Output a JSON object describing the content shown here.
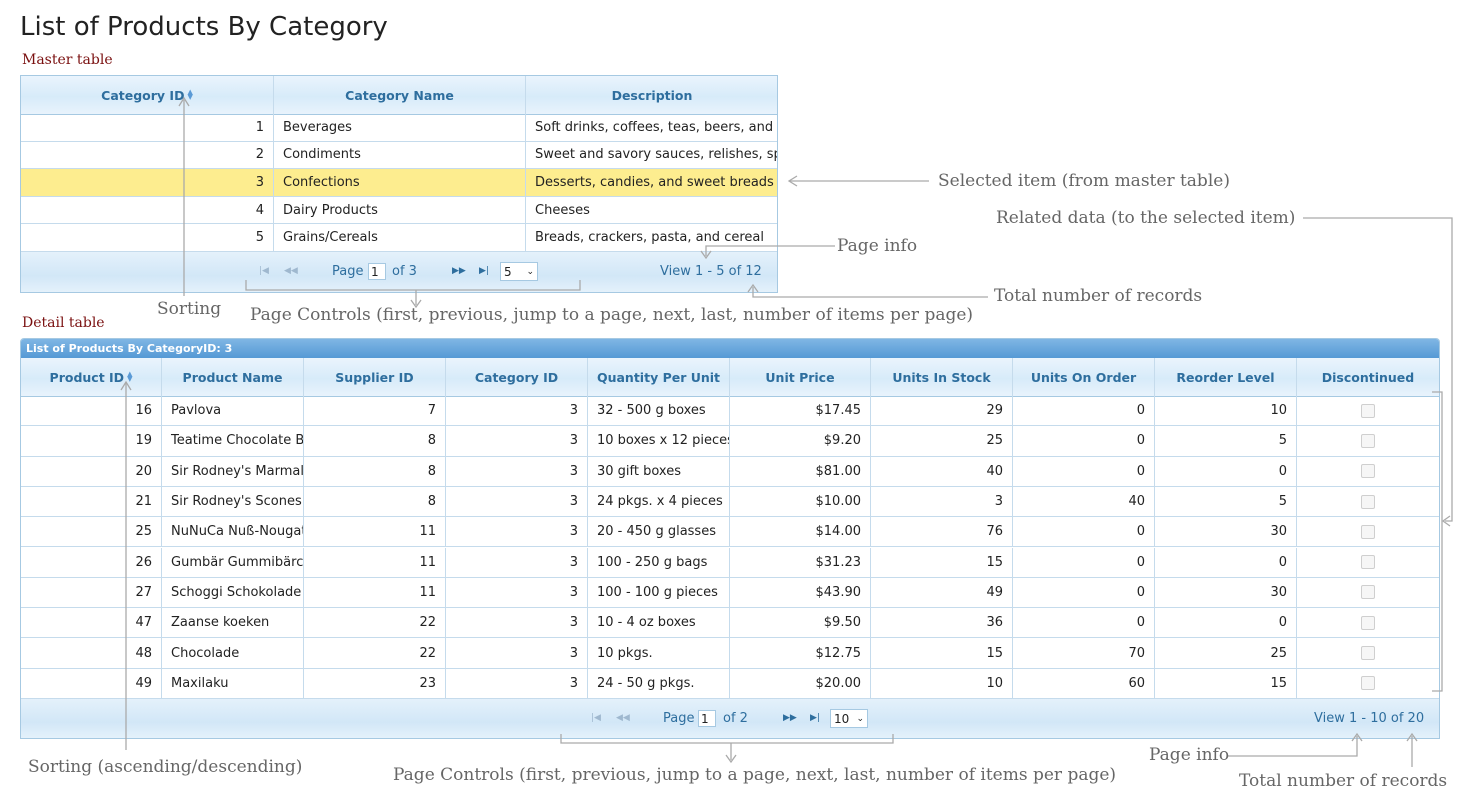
{
  "page_title": "List of Products By Category",
  "master": {
    "label": "Master table",
    "columns": [
      "Category ID",
      "Category Name",
      "Description"
    ],
    "rows": [
      {
        "id": "1",
        "name": "Beverages",
        "desc": "Soft drinks, coffees, teas, beers, and ales"
      },
      {
        "id": "2",
        "name": "Condiments",
        "desc": "Sweet and savory sauces, relishes, spreads, and seasonings"
      },
      {
        "id": "3",
        "name": "Confections",
        "desc": "Desserts, candies, and sweet breads"
      },
      {
        "id": "4",
        "name": "Dairy Products",
        "desc": "Cheeses"
      },
      {
        "id": "5",
        "name": "Grains/Cereals",
        "desc": "Breads, crackers, pasta, and cereal"
      }
    ],
    "selected_row": 2,
    "pager": {
      "page_label": "Page",
      "page_value": "1",
      "of_label": "of 3",
      "page_size": "5",
      "view_info": "View 1 - 5 of 12"
    }
  },
  "detail": {
    "label": "Detail table",
    "caption": "List of Products By CategoryID: 3",
    "columns": [
      "Product ID",
      "Product Name",
      "Supplier ID",
      "Category ID",
      "Quantity Per Unit",
      "Unit Price",
      "Units In Stock",
      "Units On Order",
      "Reorder Level",
      "Discontinued"
    ],
    "rows": [
      {
        "pid": "16",
        "name": "Pavlova",
        "sup": "7",
        "cat": "3",
        "qty": "32 - 500 g boxes",
        "price": "$17.45",
        "stock": "29",
        "order": "0",
        "reorder": "10"
      },
      {
        "pid": "19",
        "name": "Teatime Chocolate Biscuits",
        "sup": "8",
        "cat": "3",
        "qty": "10 boxes x 12 pieces",
        "price": "$9.20",
        "stock": "25",
        "order": "0",
        "reorder": "5"
      },
      {
        "pid": "20",
        "name": "Sir Rodney's Marmalade",
        "sup": "8",
        "cat": "3",
        "qty": "30 gift boxes",
        "price": "$81.00",
        "stock": "40",
        "order": "0",
        "reorder": "0"
      },
      {
        "pid": "21",
        "name": "Sir Rodney's Scones",
        "sup": "8",
        "cat": "3",
        "qty": "24 pkgs. x 4 pieces",
        "price": "$10.00",
        "stock": "3",
        "order": "40",
        "reorder": "5"
      },
      {
        "pid": "25",
        "name": "NuNuCa Nuß-Nougat-Creme",
        "sup": "11",
        "cat": "3",
        "qty": "20 - 450 g glasses",
        "price": "$14.00",
        "stock": "76",
        "order": "0",
        "reorder": "30"
      },
      {
        "pid": "26",
        "name": "Gumbär Gummibärchen",
        "sup": "11",
        "cat": "3",
        "qty": "100 - 250 g bags",
        "price": "$31.23",
        "stock": "15",
        "order": "0",
        "reorder": "0"
      },
      {
        "pid": "27",
        "name": "Schoggi Schokolade",
        "sup": "11",
        "cat": "3",
        "qty": "100 - 100 g pieces",
        "price": "$43.90",
        "stock": "49",
        "order": "0",
        "reorder": "30"
      },
      {
        "pid": "47",
        "name": "Zaanse koeken",
        "sup": "22",
        "cat": "3",
        "qty": "10 - 4 oz boxes",
        "price": "$9.50",
        "stock": "36",
        "order": "0",
        "reorder": "0"
      },
      {
        "pid": "48",
        "name": "Chocolade",
        "sup": "22",
        "cat": "3",
        "qty": "10 pkgs.",
        "price": "$12.75",
        "stock": "15",
        "order": "70",
        "reorder": "25"
      },
      {
        "pid": "49",
        "name": "Maxilaku",
        "sup": "23",
        "cat": "3",
        "qty": "24 - 50 g pkgs.",
        "price": "$20.00",
        "stock": "10",
        "order": "60",
        "reorder": "15"
      }
    ],
    "pager": {
      "page_label": "Page",
      "page_value": "1",
      "of_label": "of 2",
      "page_size": "10",
      "view_info": "View 1 - 10 of 20"
    }
  },
  "annotations": {
    "selected_item": "Selected item (from master table)",
    "related_data": "Related data (to the selected item)",
    "page_info_master": "Page info",
    "total_records_master": "Total number of records",
    "sorting_master": "Sorting",
    "page_controls_master": "Page Controls (first, previous, jump to a page, next, last, number of items per page)",
    "sorting_detail": "Sorting (ascending/descending)",
    "page_controls_detail": "Page Controls (first, previous, jump to a page, next, last, number of items per page)",
    "page_info_detail": "Page info",
    "total_records_detail": "Total number of records"
  },
  "pager_icons": [
    "first-page-icon",
    "prev-page-icon",
    "next-page-icon",
    "last-page-icon"
  ],
  "colors": {
    "header_text": "#2e6e9e",
    "border": "#a6c9e2",
    "selected_row": "#fded8f",
    "caption_bar": "#5599d5",
    "annotation": "#666666",
    "section_label": "#7a1010"
  }
}
